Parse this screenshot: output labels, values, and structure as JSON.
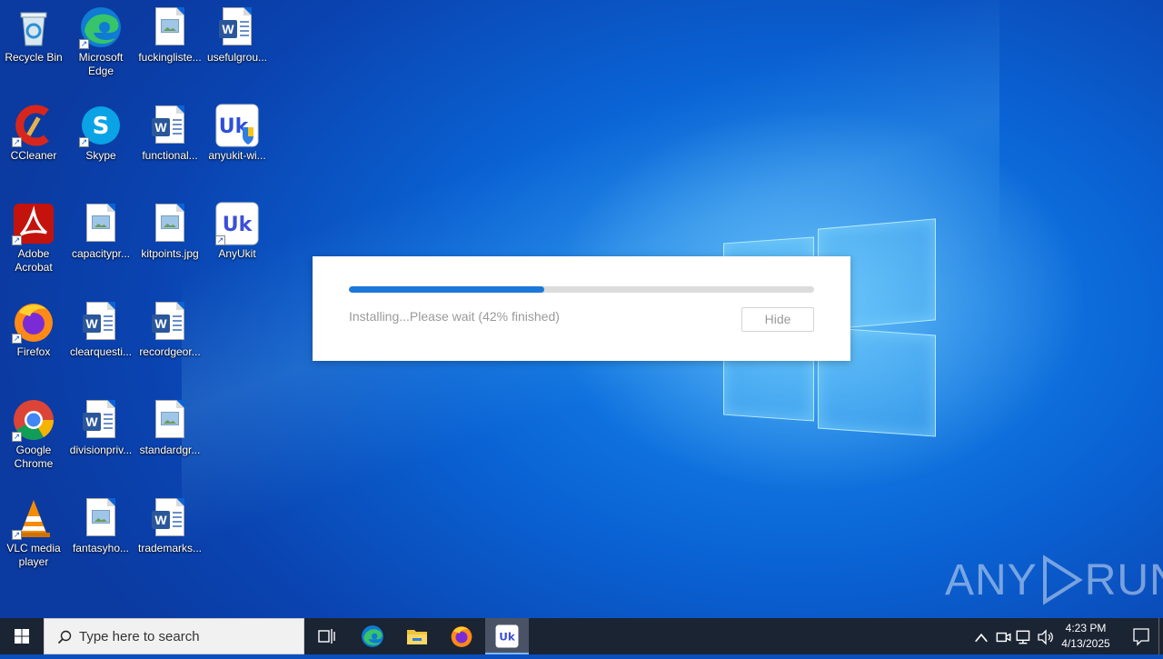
{
  "desktop_icons": [
    {
      "label": "Recycle Bin",
      "icon": "recycle-bin-icon"
    },
    {
      "label": "Microsoft Edge",
      "icon": "edge-icon"
    },
    {
      "label": "fuckingliste...",
      "icon": "image-file-icon"
    },
    {
      "label": "usefulgrou...",
      "icon": "word-doc-icon"
    },
    {
      "label": "CCleaner",
      "icon": "ccleaner-icon"
    },
    {
      "label": "Skype",
      "icon": "skype-icon"
    },
    {
      "label": "functional...",
      "icon": "word-doc-icon"
    },
    {
      "label": "anyukit-wi...",
      "icon": "anyukit-installer-icon"
    },
    {
      "label": "Adobe Acrobat",
      "icon": "acrobat-icon"
    },
    {
      "label": "capacitypr...",
      "icon": "image-file-icon"
    },
    {
      "label": "kitpoints.jpg",
      "icon": "image-file-icon"
    },
    {
      "label": "AnyUkit",
      "icon": "anyukit-icon"
    },
    {
      "label": "Firefox",
      "icon": "firefox-icon"
    },
    {
      "label": "clearquesti...",
      "icon": "word-doc-icon"
    },
    {
      "label": "recordgeor...",
      "icon": "word-doc-icon"
    },
    {
      "label": "Google Chrome",
      "icon": "chrome-icon"
    },
    {
      "label": "divisionpriv...",
      "icon": "word-doc-icon"
    },
    {
      "label": "standardgr...",
      "icon": "image-file-icon"
    },
    {
      "label": "VLC media player",
      "icon": "vlc-icon"
    },
    {
      "label": "fantasyho...",
      "icon": "image-file-icon"
    },
    {
      "label": "trademarks...",
      "icon": "word-doc-icon"
    }
  ],
  "dialog": {
    "progress_fraction": 0.42,
    "status_text": "Installing...Please wait (42% finished)",
    "hide_label": "Hide"
  },
  "watermark": {
    "left": "ANY",
    "right": "RUN"
  },
  "taskbar": {
    "search_placeholder": "Type here to search",
    "pinned": [
      "task-view-icon",
      "edge-icon",
      "file-explorer-icon",
      "firefox-icon",
      "anyukit-icon"
    ],
    "active_app": "anyukit-icon",
    "clock_time": "4:23 PM",
    "clock_date": "4/13/2025"
  },
  "colors": {
    "accent": "#1c78d8",
    "taskbar_bg": "#1b2433"
  }
}
